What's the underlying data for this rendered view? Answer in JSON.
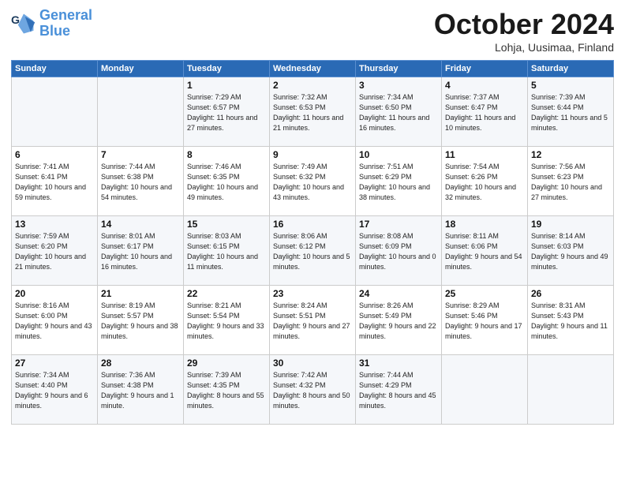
{
  "header": {
    "logo_general": "General",
    "logo_blue": "Blue",
    "month": "October 2024",
    "location": "Lohja, Uusimaa, Finland"
  },
  "weekdays": [
    "Sunday",
    "Monday",
    "Tuesday",
    "Wednesday",
    "Thursday",
    "Friday",
    "Saturday"
  ],
  "weeks": [
    [
      {
        "day": "",
        "sunrise": "",
        "sunset": "",
        "daylight": ""
      },
      {
        "day": "",
        "sunrise": "",
        "sunset": "",
        "daylight": ""
      },
      {
        "day": "1",
        "sunrise": "Sunrise: 7:29 AM",
        "sunset": "Sunset: 6:57 PM",
        "daylight": "Daylight: 11 hours and 27 minutes."
      },
      {
        "day": "2",
        "sunrise": "Sunrise: 7:32 AM",
        "sunset": "Sunset: 6:53 PM",
        "daylight": "Daylight: 11 hours and 21 minutes."
      },
      {
        "day": "3",
        "sunrise": "Sunrise: 7:34 AM",
        "sunset": "Sunset: 6:50 PM",
        "daylight": "Daylight: 11 hours and 16 minutes."
      },
      {
        "day": "4",
        "sunrise": "Sunrise: 7:37 AM",
        "sunset": "Sunset: 6:47 PM",
        "daylight": "Daylight: 11 hours and 10 minutes."
      },
      {
        "day": "5",
        "sunrise": "Sunrise: 7:39 AM",
        "sunset": "Sunset: 6:44 PM",
        "daylight": "Daylight: 11 hours and 5 minutes."
      }
    ],
    [
      {
        "day": "6",
        "sunrise": "Sunrise: 7:41 AM",
        "sunset": "Sunset: 6:41 PM",
        "daylight": "Daylight: 10 hours and 59 minutes."
      },
      {
        "day": "7",
        "sunrise": "Sunrise: 7:44 AM",
        "sunset": "Sunset: 6:38 PM",
        "daylight": "Daylight: 10 hours and 54 minutes."
      },
      {
        "day": "8",
        "sunrise": "Sunrise: 7:46 AM",
        "sunset": "Sunset: 6:35 PM",
        "daylight": "Daylight: 10 hours and 49 minutes."
      },
      {
        "day": "9",
        "sunrise": "Sunrise: 7:49 AM",
        "sunset": "Sunset: 6:32 PM",
        "daylight": "Daylight: 10 hours and 43 minutes."
      },
      {
        "day": "10",
        "sunrise": "Sunrise: 7:51 AM",
        "sunset": "Sunset: 6:29 PM",
        "daylight": "Daylight: 10 hours and 38 minutes."
      },
      {
        "day": "11",
        "sunrise": "Sunrise: 7:54 AM",
        "sunset": "Sunset: 6:26 PM",
        "daylight": "Daylight: 10 hours and 32 minutes."
      },
      {
        "day": "12",
        "sunrise": "Sunrise: 7:56 AM",
        "sunset": "Sunset: 6:23 PM",
        "daylight": "Daylight: 10 hours and 27 minutes."
      }
    ],
    [
      {
        "day": "13",
        "sunrise": "Sunrise: 7:59 AM",
        "sunset": "Sunset: 6:20 PM",
        "daylight": "Daylight: 10 hours and 21 minutes."
      },
      {
        "day": "14",
        "sunrise": "Sunrise: 8:01 AM",
        "sunset": "Sunset: 6:17 PM",
        "daylight": "Daylight: 10 hours and 16 minutes."
      },
      {
        "day": "15",
        "sunrise": "Sunrise: 8:03 AM",
        "sunset": "Sunset: 6:15 PM",
        "daylight": "Daylight: 10 hours and 11 minutes."
      },
      {
        "day": "16",
        "sunrise": "Sunrise: 8:06 AM",
        "sunset": "Sunset: 6:12 PM",
        "daylight": "Daylight: 10 hours and 5 minutes."
      },
      {
        "day": "17",
        "sunrise": "Sunrise: 8:08 AM",
        "sunset": "Sunset: 6:09 PM",
        "daylight": "Daylight: 10 hours and 0 minutes."
      },
      {
        "day": "18",
        "sunrise": "Sunrise: 8:11 AM",
        "sunset": "Sunset: 6:06 PM",
        "daylight": "Daylight: 9 hours and 54 minutes."
      },
      {
        "day": "19",
        "sunrise": "Sunrise: 8:14 AM",
        "sunset": "Sunset: 6:03 PM",
        "daylight": "Daylight: 9 hours and 49 minutes."
      }
    ],
    [
      {
        "day": "20",
        "sunrise": "Sunrise: 8:16 AM",
        "sunset": "Sunset: 6:00 PM",
        "daylight": "Daylight: 9 hours and 43 minutes."
      },
      {
        "day": "21",
        "sunrise": "Sunrise: 8:19 AM",
        "sunset": "Sunset: 5:57 PM",
        "daylight": "Daylight: 9 hours and 38 minutes."
      },
      {
        "day": "22",
        "sunrise": "Sunrise: 8:21 AM",
        "sunset": "Sunset: 5:54 PM",
        "daylight": "Daylight: 9 hours and 33 minutes."
      },
      {
        "day": "23",
        "sunrise": "Sunrise: 8:24 AM",
        "sunset": "Sunset: 5:51 PM",
        "daylight": "Daylight: 9 hours and 27 minutes."
      },
      {
        "day": "24",
        "sunrise": "Sunrise: 8:26 AM",
        "sunset": "Sunset: 5:49 PM",
        "daylight": "Daylight: 9 hours and 22 minutes."
      },
      {
        "day": "25",
        "sunrise": "Sunrise: 8:29 AM",
        "sunset": "Sunset: 5:46 PM",
        "daylight": "Daylight: 9 hours and 17 minutes."
      },
      {
        "day": "26",
        "sunrise": "Sunrise: 8:31 AM",
        "sunset": "Sunset: 5:43 PM",
        "daylight": "Daylight: 9 hours and 11 minutes."
      }
    ],
    [
      {
        "day": "27",
        "sunrise": "Sunrise: 7:34 AM",
        "sunset": "Sunset: 4:40 PM",
        "daylight": "Daylight: 9 hours and 6 minutes."
      },
      {
        "day": "28",
        "sunrise": "Sunrise: 7:36 AM",
        "sunset": "Sunset: 4:38 PM",
        "daylight": "Daylight: 9 hours and 1 minute."
      },
      {
        "day": "29",
        "sunrise": "Sunrise: 7:39 AM",
        "sunset": "Sunset: 4:35 PM",
        "daylight": "Daylight: 8 hours and 55 minutes."
      },
      {
        "day": "30",
        "sunrise": "Sunrise: 7:42 AM",
        "sunset": "Sunset: 4:32 PM",
        "daylight": "Daylight: 8 hours and 50 minutes."
      },
      {
        "day": "31",
        "sunrise": "Sunrise: 7:44 AM",
        "sunset": "Sunset: 4:29 PM",
        "daylight": "Daylight: 8 hours and 45 minutes."
      },
      {
        "day": "",
        "sunrise": "",
        "sunset": "",
        "daylight": ""
      },
      {
        "day": "",
        "sunrise": "",
        "sunset": "",
        "daylight": ""
      }
    ]
  ]
}
